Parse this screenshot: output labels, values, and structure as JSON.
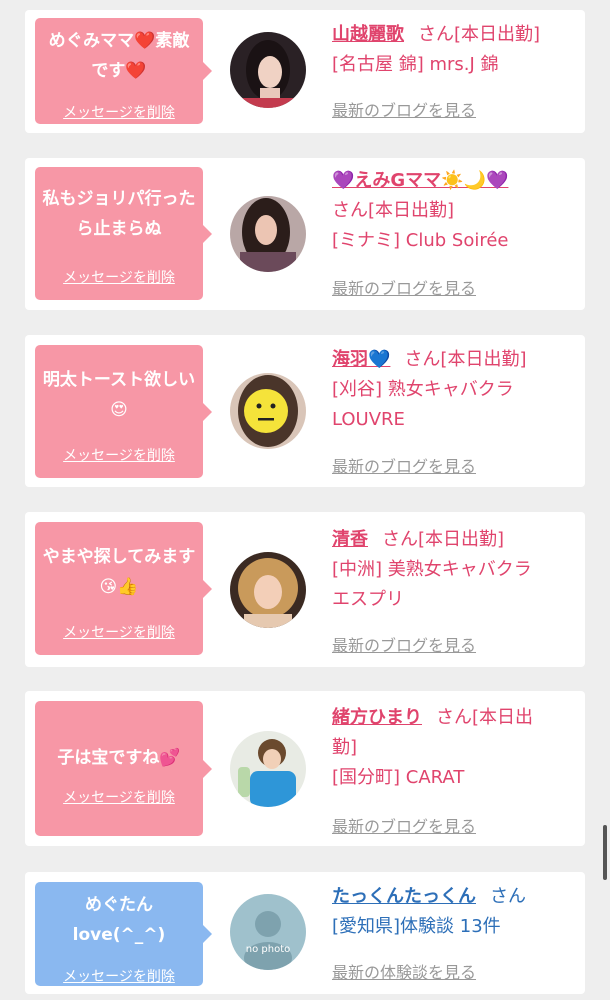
{
  "entries": [
    {
      "message": "めぐみママ❤️素敵です❤️",
      "delete_label": "メッセージを削除",
      "name": "山越麗歌",
      "suffix": "さん[本日出勤]",
      "line2": "[名古屋 錦] mrs.J 錦",
      "line3": "",
      "link": "最新のブログを見る",
      "bubble_color": "pink",
      "avatar": "woman-dark-hair-photo"
    },
    {
      "message": "私もジョリパ行ったら止まらぬ",
      "delete_label": "メッセージを削除",
      "name": "💜えみGママ☀️🌙💜",
      "suffix": "さん[本日出勤]",
      "line2": "[ミナミ] Club Soirée",
      "line3": "",
      "link": "最新のブログを見る",
      "bubble_color": "pink",
      "avatar": "woman-long-hair-photo"
    },
    {
      "message": "明太トースト欲しい😍",
      "delete_label": "メッセージを削除",
      "name": "海羽💙",
      "suffix": "さん[本日出勤]",
      "line2": "[刈谷] 熟女キャバクラ",
      "line3": "LOUVRE",
      "link": "最新のブログを見る",
      "bubble_color": "pink",
      "avatar": "face-emoji-covered-photo"
    },
    {
      "message": "やまや探してみます😘👍",
      "delete_label": "メッセージを削除",
      "name": "清香",
      "suffix": "さん[本日出勤]",
      "line2": "[中洲] 美熟女キャバクラ",
      "line3": "エスプリ",
      "link": "最新のブログを見る",
      "bubble_color": "pink",
      "avatar": "woman-blonde-curls-photo"
    },
    {
      "message": "子は宝ですね💕",
      "delete_label": "メッセージを削除",
      "name": "緒方ひまり",
      "suffix": "さん[本日出",
      "suffix2": "勤]",
      "line2": "[国分町] CARAT",
      "line3": "",
      "link": "最新のブログを見る",
      "bubble_color": "pink",
      "avatar": "woman-blue-shirt-photo"
    },
    {
      "message": "めぐたんlove(^_^)",
      "delete_label": "メッセージを削除",
      "name": "たっくんたっくん",
      "suffix": "さん",
      "line2": "[愛知県]体験談 13件",
      "line3": "",
      "link": "最新の体験談を見る",
      "bubble_color": "blue",
      "avatar": "no-photo-placeholder",
      "avatar_text": "no photo"
    }
  ],
  "colors": {
    "pink_bubble": "#f797a6",
    "blue_bubble": "#8ab8f0",
    "name_pink": "#e0446d",
    "name_blue": "#2d6fb8",
    "link_gray": "#999999"
  }
}
